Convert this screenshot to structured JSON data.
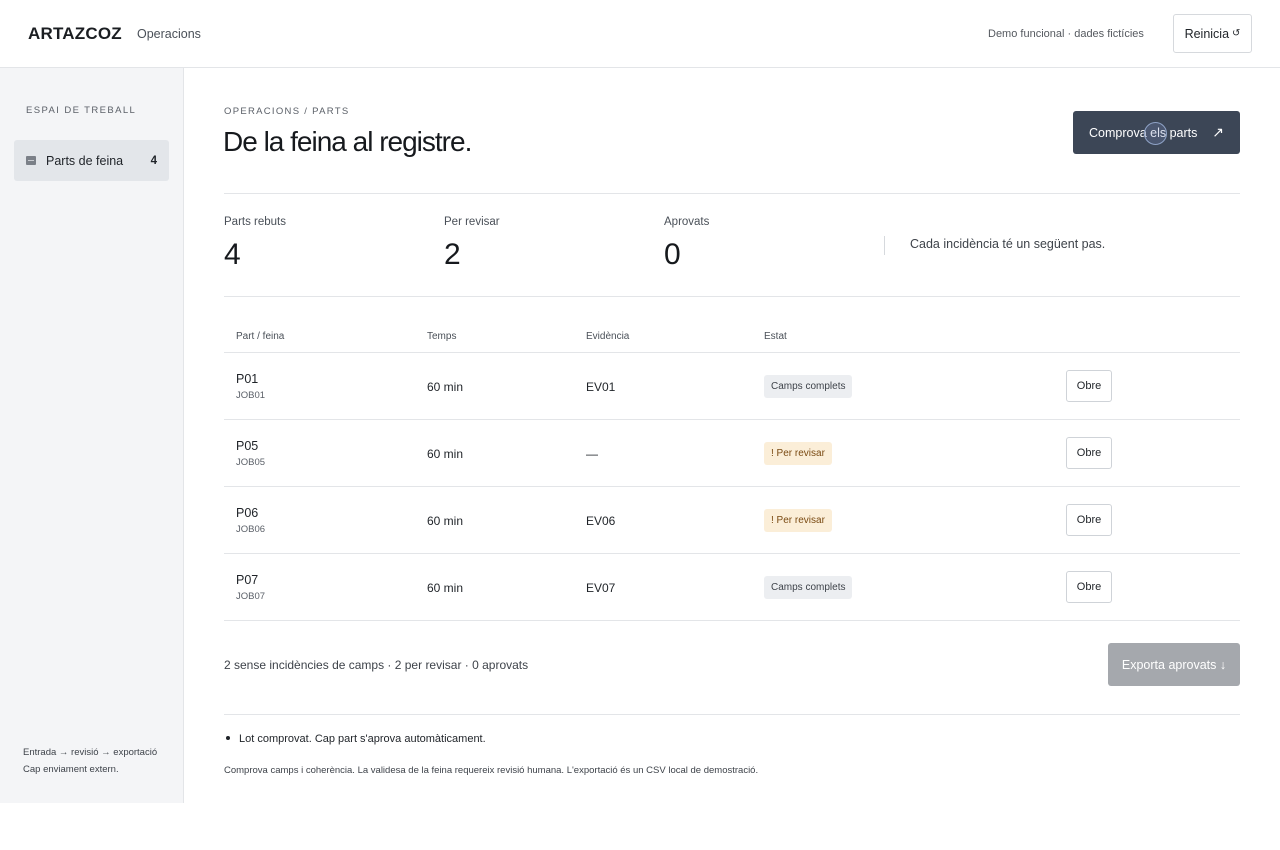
{
  "header": {
    "brand": "ARTAZCOZ",
    "app_name": "Operacions",
    "demo_note": "Demo funcional · dades fictícies",
    "reset_label": "Reinicia",
    "reset_icon": "↺"
  },
  "sidebar": {
    "heading": "ESPAI DE TREBALL",
    "items": [
      {
        "label": "Parts de feina",
        "count": "4",
        "icon": "list-icon"
      }
    ],
    "footer_line1": "Entrada → revisió → exportació",
    "footer_line2": "Cap enviament extern."
  },
  "main": {
    "breadcrumb": "OPERACIONS / PARTS",
    "title": "De la feina al registre.",
    "check_label": "Comprova els parts",
    "check_icon": "↗",
    "stats": [
      {
        "label": "Parts rebuts",
        "value": "4"
      },
      {
        "label": "Per revisar",
        "value": "2"
      },
      {
        "label": "Aprovats",
        "value": "0"
      }
    ],
    "stat_note": "Cada incidència té un següent pas.",
    "table": {
      "headers": [
        "Part / feina",
        "Temps",
        "Evidència",
        "Estat"
      ],
      "rows": [
        {
          "part": "P01",
          "job": "JOB01",
          "time": "60 min",
          "evidence": "EV01",
          "status": "Camps complets",
          "status_kind": "ok",
          "action": "Obre"
        },
        {
          "part": "P05",
          "job": "JOB05",
          "time": "60 min",
          "evidence": "—",
          "status": "! Per revisar",
          "status_kind": "warn",
          "action": "Obre"
        },
        {
          "part": "P06",
          "job": "JOB06",
          "time": "60 min",
          "evidence": "EV06",
          "status": "! Per revisar",
          "status_kind": "warn",
          "action": "Obre"
        },
        {
          "part": "P07",
          "job": "JOB07",
          "time": "60 min",
          "evidence": "EV07",
          "status": "Camps complets",
          "status_kind": "ok",
          "action": "Obre"
        }
      ]
    },
    "summary": "2 sense incidències de camps · 2 per revisar · 0 aprovats",
    "export_label": "Exporta aprovats ↓",
    "bullet": "Lot comprovat. Cap part s'aprova automàticament.",
    "disclaimer": "Comprova camps i coherència. La validesa de la feina requereix revisió humana. L'exportació és un CSV local de demostració."
  },
  "colors": {
    "primary_button": "#3c4656",
    "disabled_button": "#a5a8ad",
    "warn_badge_bg": "#fbeed8",
    "warn_badge_text": "#7a4a12",
    "ok_badge_bg": "#eceef1"
  }
}
